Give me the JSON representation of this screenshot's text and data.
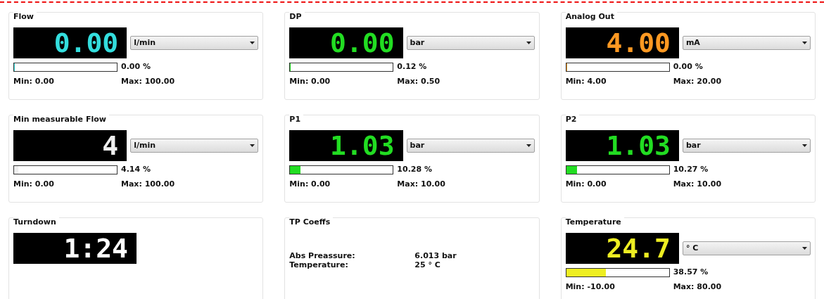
{
  "panels": [
    {
      "kind": "meter",
      "title": "Flow",
      "readout": "0.00",
      "color": "#33dddd",
      "unit": "l/min",
      "level": 0,
      "percent": "0.00 %",
      "min": "Min: 0.00",
      "max": "Max: 100.00"
    },
    {
      "kind": "meter",
      "title": "DP",
      "readout": "0.00",
      "color": "#22dd22",
      "unit": "bar",
      "level": 0.0012,
      "percent": "0.12 %",
      "min": "Min: 0.00",
      "max": "Max: 0.50"
    },
    {
      "kind": "meter",
      "title": "Analog Out",
      "readout": "4.00",
      "color": "#ff9922",
      "unit": "mA",
      "level": 0,
      "percent": "0.00 %",
      "min": "Min: 4.00",
      "max": "Max: 20.00"
    },
    {
      "kind": "meter",
      "title": "Min measurable Flow",
      "readout": "4",
      "color": "#eeeeee",
      "unit": "l/min",
      "level": 0.0414,
      "percent": "4.14 %",
      "min": "Min: 0.00",
      "max": "Max: 100.00"
    },
    {
      "kind": "meter",
      "title": "P1",
      "readout": "1.03",
      "color": "#22dd22",
      "unit": "bar",
      "level": 0.1028,
      "percent": "10.28 %",
      "min": "Min: 0.00",
      "max": "Max: 10.00"
    },
    {
      "kind": "meter",
      "title": "P2",
      "readout": "1.03",
      "color": "#22dd22",
      "unit": "bar",
      "level": 0.1027,
      "percent": "10.27 %",
      "min": "Min: 0.00",
      "max": "Max: 10.00"
    },
    {
      "kind": "display",
      "title": "Turndown",
      "readout": "1:24",
      "color": "#ffffff"
    },
    {
      "kind": "coeffs",
      "title": "TP Coeffs",
      "rows": [
        {
          "label": "Abs Preassure:",
          "value": "6.013 bar"
        },
        {
          "label": "Temperature:",
          "value": "25 ° C"
        }
      ]
    },
    {
      "kind": "meter",
      "title": "Temperature",
      "readout": "24.7",
      "color": "#eeee22",
      "unit": "° C",
      "level": 0.3857,
      "percent": "38.57 %",
      "min": "Min: -10.00",
      "max": "Max: 80.00"
    }
  ]
}
